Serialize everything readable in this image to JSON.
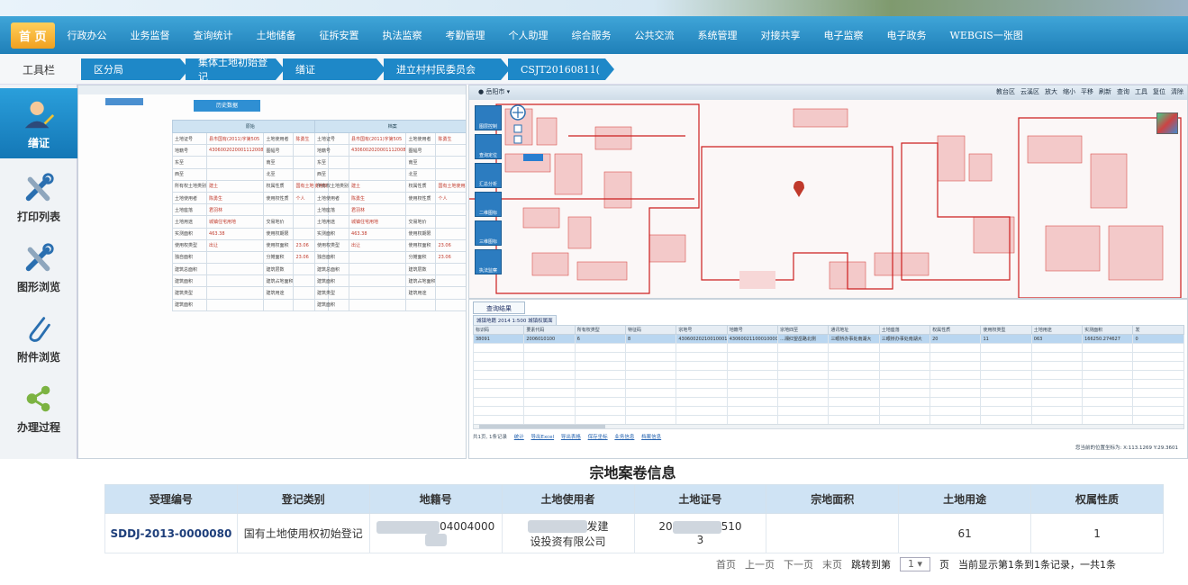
{
  "topnav": {
    "home": "首 页",
    "items": [
      "行政办公",
      "业务监督",
      "查询统计",
      "土地储备",
      "征拆安置",
      "执法监察",
      "考勤管理",
      "个人助理",
      "综合服务",
      "公共交流",
      "系统管理",
      "对接共享",
      "电子监察",
      "电子政务",
      "WEBGIS一张图"
    ]
  },
  "toolbar_title": "工具栏",
  "breadcrumbs": [
    "区分局",
    "集体土地初始登记",
    "缮证",
    "进立村村民委员会",
    "CSJT20160811("
  ],
  "sidebar": {
    "items": [
      {
        "label": "缮证",
        "icon": "user-pen-icon"
      },
      {
        "label": "打印列表",
        "icon": "tools-icon"
      },
      {
        "label": "图形浏览",
        "icon": "tools-icon"
      },
      {
        "label": "附件浏览",
        "icon": "paperclip-icon"
      },
      {
        "label": "办理过程",
        "icon": "share-nodes-icon"
      }
    ]
  },
  "doc": {
    "history_button": "历史数据",
    "left_title": "原始",
    "right_title": "档案",
    "rows": [
      [
        "土地证号",
        "县市国有(2011)字第505",
        "土地使用者",
        "陈勇生"
      ],
      [
        "地籍号",
        "4306002020001112008",
        "图幅号",
        ""
      ],
      [
        "东至",
        "",
        "南至",
        ""
      ],
      [
        "西至",
        "",
        "北至",
        ""
      ],
      [
        "所有权土地类别",
        "建土",
        "权属性质",
        "国有土地使用权"
      ],
      [
        "土地使用者",
        "陈勇生",
        "使用权性质",
        "个人"
      ],
      [
        "土地座落",
        "君羽林",
        "",
        ""
      ],
      [
        "土地用途",
        "城镇住宅用地",
        "交易地价",
        ""
      ],
      [
        "实测面积",
        "463.38",
        "使用权期限",
        ""
      ],
      [
        "使用权类型",
        "出让",
        "使用权面积",
        "23.06"
      ],
      [
        "独自面积",
        "",
        "分摊面积",
        "23.06"
      ],
      [
        "建筑总面积",
        "",
        "建筑层数",
        ""
      ],
      [
        "建筑面积",
        "",
        "建筑占地面积",
        ""
      ],
      [
        "建筑类型",
        "",
        "建筑用途",
        ""
      ],
      [
        "建筑面积",
        "",
        "",
        ""
      ]
    ]
  },
  "map": {
    "location": "岳阳市",
    "tools": [
      "教台区",
      "云溪区",
      "放大",
      "缩小",
      "平移",
      "刷新",
      "查询",
      "工具",
      "复位",
      "清除"
    ],
    "left_tools": [
      "图层控制",
      "查询定位",
      "汇总分析",
      "二维图标",
      "三维图标",
      "执法监察"
    ]
  },
  "results": {
    "tab": "查询结果",
    "sub_tab": "城镇地籍 2014 1:500 城镇权属面",
    "columns": [
      "标识码",
      "要素代码",
      "所有权类型",
      "特征码",
      "宗地号",
      "地籍号",
      "宗地四至",
      "通讯地址",
      "土地座落",
      "权属性质",
      "使用权类型",
      "土地用途",
      "实测面积",
      "发"
    ],
    "row": [
      "38091",
      "2006010100",
      "6",
      "8",
      "4306002021001000100",
      "4306002110001000021",
      "...湘红望岳路北侧",
      "三眼桥办事处南湖大",
      "三眼桥办事处南湖大",
      "20",
      "11",
      "063",
      "166250.274627",
      "0"
    ],
    "pager_text": "共1页, 1条记录",
    "links": [
      "统计",
      "导出Excel",
      "导出表格",
      "保存坐标",
      "业务信息",
      "档案信息"
    ],
    "coord_text": "您当前的位置坐标为: X:113.1269   Y:29.3601"
  },
  "info": {
    "title": "宗地案卷信息",
    "columns": [
      "受理编号",
      "登记类别",
      "地籍号",
      "土地使用者",
      "土地证号",
      "宗地面积",
      "土地用途",
      "权属性质"
    ],
    "row": {
      "accept_no": "SDDJ-2013-0000080",
      "category": "国有土地使用权初始登记",
      "cadastral_no": "04004000",
      "user_line1": "发建",
      "user_line2": "设投资有限公司",
      "cert_left": "20",
      "cert_right": "510",
      "cert_line2": "3",
      "area": "",
      "use": "61",
      "nature": "1"
    },
    "pager": {
      "first": "首页",
      "prev": "上一页",
      "next": "下一页",
      "last": "末页",
      "jump_label": "跳转到第",
      "jump_value": "1",
      "page_unit": "页",
      "status": "当前显示第1条到1条记录，一共1条"
    }
  }
}
